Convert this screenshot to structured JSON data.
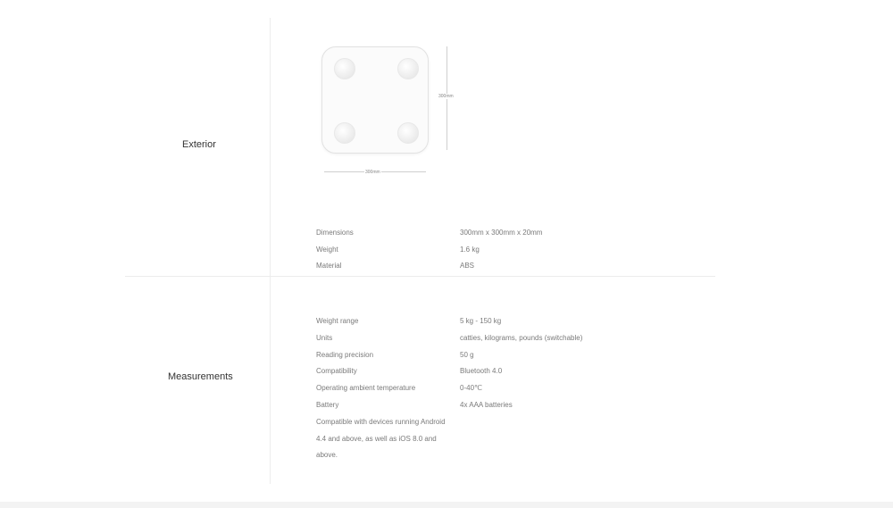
{
  "exterior": {
    "title": "Exterior",
    "illustration": {
      "width_label": "300mm",
      "height_label": "300mm"
    },
    "specs": [
      {
        "label": "Dimensions",
        "value": "300mm x 300mm x 20mm"
      },
      {
        "label": "Weight",
        "value": "1.6 kg"
      },
      {
        "label": "Material",
        "value": "ABS"
      }
    ]
  },
  "measurements": {
    "title": "Measurements",
    "specs": [
      {
        "label": "Weight range",
        "value": "5 kg - 150 kg"
      },
      {
        "label": "Units",
        "value": "catties, kilograms, pounds (switchable)"
      },
      {
        "label": "Reading precision",
        "value": "50 g"
      },
      {
        "label": "Compatibility",
        "value": "Bluetooth 4.0"
      },
      {
        "label": "Operating ambient temperature",
        "value": "0-40℃"
      },
      {
        "label": "Battery",
        "value": "4x AAA batteries"
      }
    ],
    "note_lines": [
      "Compatible with devices running Android",
      "4.4 and above, as well as iOS 8.0 and",
      "above."
    ]
  }
}
